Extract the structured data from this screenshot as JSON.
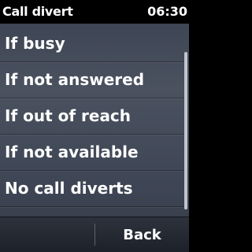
{
  "statusbar": {
    "title": "Call divert",
    "time": "06:30"
  },
  "menu": {
    "items": [
      {
        "label": "If busy"
      },
      {
        "label": "If not answered"
      },
      {
        "label": "If out of reach"
      },
      {
        "label": "If not available"
      },
      {
        "label": "No call diverts"
      }
    ]
  },
  "softkeys": {
    "right_label": "Back"
  },
  "colors": {
    "statusbar_bg": "#000000",
    "text": "#ffffff",
    "scrollbar": "#cfd3d8"
  }
}
